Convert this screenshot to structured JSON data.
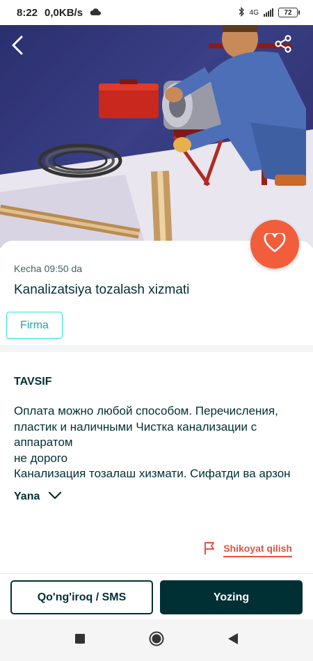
{
  "status_bar": {
    "time": "8:22",
    "network_speed": "0,0KB/s",
    "network_type": "4G",
    "battery": "72",
    "icons": [
      "cloud-icon",
      "bluetooth-icon",
      "signal-icon",
      "battery-icon"
    ]
  },
  "hero": {
    "image_alt": "",
    "icons": [
      "back-arrow-icon",
      "share-icon",
      "heart-icon"
    ]
  },
  "listing": {
    "date": "Kecha 09:50 da",
    "title": "Kanalizatsiya tozalash xizmati",
    "badge": "Firma"
  },
  "description": {
    "heading": "TAVSIF",
    "text": "Оплата можно любой способом. Перечисления, пластик и наличными Чистка канализации с аппаратом\nне дорого\nКанализация тозалаш хизмати. Сифатди ва арзон",
    "more_label": "Yana"
  },
  "report": {
    "label": "Shikoyat qilish"
  },
  "actions": {
    "call_label": "Qo'ng'iroq / SMS",
    "write_label": "Yozing"
  },
  "colors": {
    "accent": "#f25d3c",
    "dark": "#002f34",
    "badge_border": "#23e5db",
    "report": "#e6523a"
  }
}
